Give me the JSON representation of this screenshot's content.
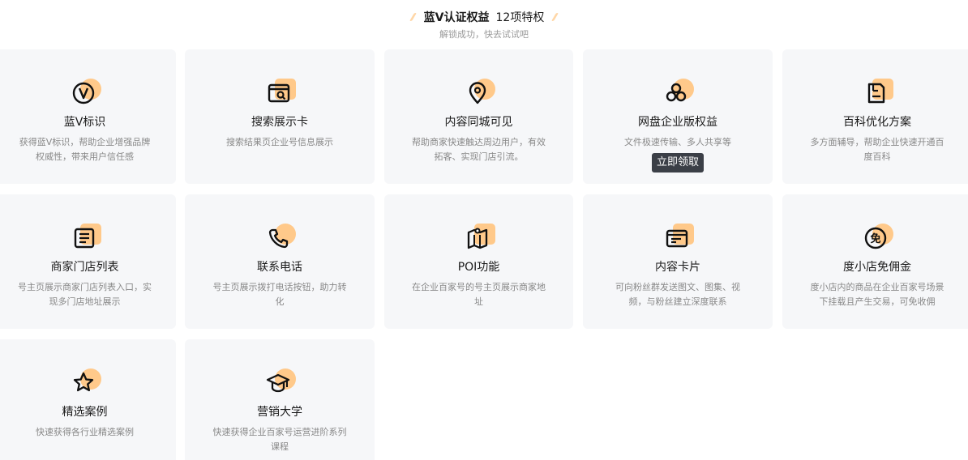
{
  "header": {
    "title": "蓝V认证权益",
    "count": "12项特权",
    "subtitle": "解锁成功，快去试试吧"
  },
  "cards": [
    {
      "title": "蓝V标识",
      "desc": "获得蓝V标识，帮助企业增强品牌权威性，带来用户信任感",
      "icon": "blue-v-badge-icon"
    },
    {
      "title": "搜索展示卡",
      "desc": "搜索结果页企业号信息展示",
      "icon": "search-card-icon"
    },
    {
      "title": "内容同城可见",
      "desc": "帮助商家快速触达周边用户，有效拓客、实现门店引流。",
      "icon": "location-pin-icon"
    },
    {
      "title": "网盘企业版权益",
      "desc": "文件极速传输、多人共享等",
      "icon": "cloud-disk-icon",
      "button": "立即领取"
    },
    {
      "title": "百科优化方案",
      "desc": "多方面辅导，帮助企业快速开通百度百科",
      "icon": "encyclopedia-icon"
    },
    {
      "title": "商家门店列表",
      "desc": "号主页展示商家门店列表入口，实现多门店地址展示",
      "icon": "store-list-icon"
    },
    {
      "title": "联系电话",
      "desc": "号主页展示拨打电话按钮，助力转化",
      "icon": "phone-icon"
    },
    {
      "title": "POI功能",
      "desc": "在企业百家号的号主页展示商家地址",
      "icon": "poi-map-icon"
    },
    {
      "title": "内容卡片",
      "desc": "可向粉丝群发送图文、图集、视频，与粉丝建立深度联系",
      "icon": "content-card-icon"
    },
    {
      "title": "度小店免佣金",
      "desc": "度小店内的商品在企业百家号场景下挂载且产生交易，可免收佣",
      "icon": "commission-free-icon"
    },
    {
      "title": "精选案例",
      "desc": "快速获得各行业精选案例",
      "icon": "star-icon"
    },
    {
      "title": "营销大学",
      "desc": "快速获得企业百家号运营进阶系列课程",
      "icon": "graduation-cap-icon"
    }
  ]
}
